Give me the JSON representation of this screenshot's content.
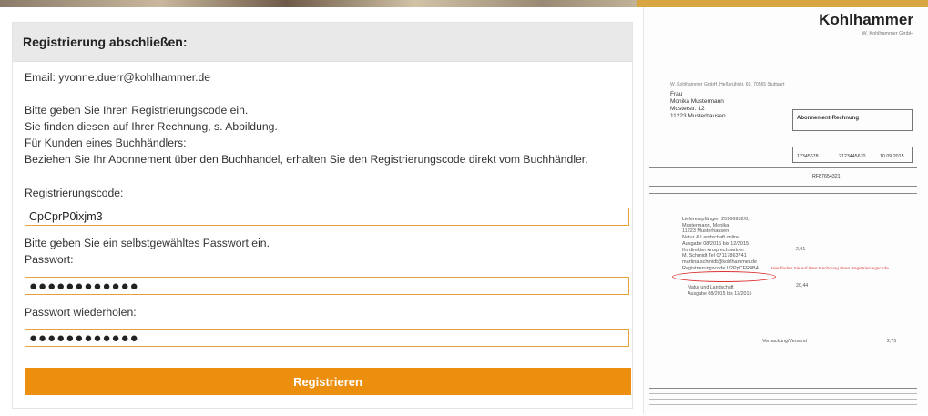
{
  "form": {
    "title": "Registrierung abschließen:",
    "email_text": "Email: yvonne.duerr@kohlhammer.de",
    "instructions": [
      "Bitte geben Sie Ihren Registrierungscode ein.",
      "Sie finden diesen auf Ihrer Rechnung, s. Abbildung.",
      "Für Kunden eines Buchhändlers:",
      "Beziehen Sie Ihr Abonnement über den Buchhandel, erhalten Sie den Registrierungscode direkt vom Buchhändler."
    ],
    "code_label": "Registrierungscode:",
    "code_value": "CpCprP0ixjm3",
    "password_intro": "Bitte geben Sie ein selbstgewähltes Passwort ein.",
    "password_label": "Passwort:",
    "password_value": "●●●●●●●●●●●●",
    "password_repeat_label": "Passwort wiederholen:",
    "password_repeat_value": "●●●●●●●●●●●●",
    "submit_label": "Registrieren"
  },
  "invoice": {
    "logo": "Kohlhammer",
    "company": "W. Kohlhammer GmbH",
    "sender_line": "W. Kohlhammer GmbH, Heßbrühlstr. 69, 70565 Stuttgart",
    "recipient": [
      "Frau",
      "Monika Mustermann",
      "Musterstr. 12",
      "11223 Musterhausen"
    ],
    "doc_title": "Abonnement-Rechnung",
    "customer_no": "12345678",
    "invoice_no": "2123445670",
    "invoice_date": "10.09.2015",
    "order_no": "RF87654321",
    "item_lines": [
      "Lieferempfänger: 25966952/0,",
      "Mustermann, Monika",
      "11223 Musterhausen",
      "Natur & Landschaft online",
      "Ausgabe 08/2015 bis 12/2015",
      "Ihr direkter Ansprechpartner",
      "M. Schmidt Tel 07117863741",
      "martina.schmidt@kohlhammer.de",
      "Registrierungscode U2PpCFR4B4"
    ],
    "note_red": "Hier finden Sie auf Ihrer Rechnung Ihren Registrierungscode.",
    "item2": "Natur und Landschaft",
    "item2_period": "Ausgabe 08/2015 bis 12/2015",
    "amount1": "2,91",
    "amount2": "20,44",
    "shipping_label": "Verpackung/Versand",
    "shipping_amount": "2,75"
  },
  "colors": {
    "accent": "#ec8f0e",
    "field_border": "#e5a23a",
    "header_bg": "#e9e9e9"
  }
}
